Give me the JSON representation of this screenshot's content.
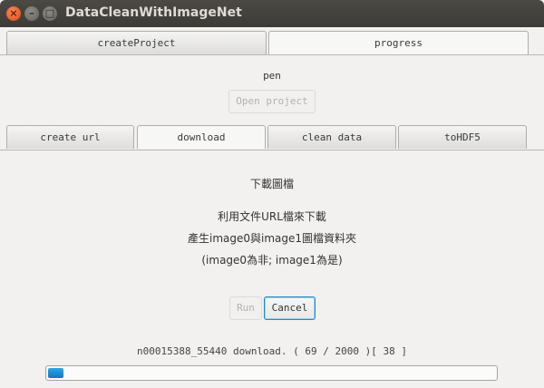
{
  "window": {
    "title": "DataCleanWithImageNet",
    "close_glyph": "×",
    "min_glyph": "–",
    "max_glyph": "□"
  },
  "top_tabs": [
    {
      "label": "createProject",
      "selected": false
    },
    {
      "label": "progress",
      "selected": true
    }
  ],
  "project": {
    "name": "pen",
    "open_button": "Open project",
    "open_enabled": false
  },
  "sub_tabs": [
    {
      "label": "create url",
      "selected": false
    },
    {
      "label": "download",
      "selected": true
    },
    {
      "label": "clean data",
      "selected": false
    },
    {
      "label": "toHDF5",
      "selected": false
    }
  ],
  "download": {
    "heading": "下載圖檔",
    "line1": "利用文件URL檔來下載",
    "line2": "產生image0與image1圖檔資料夾",
    "line3": "(image0為非; image1為是)",
    "run_button": "Run",
    "cancel_button": "Cancel",
    "run_enabled": false,
    "status": "n00015388_55440 download. ( 69 / 2000 )[ 38 ]",
    "progress_fraction": 0.0345
  },
  "colors": {
    "accent": "#1f8bc9",
    "progress_fill": "#1a88cf",
    "titlebar": "#3c3b37",
    "close_button": "#df4b16"
  }
}
